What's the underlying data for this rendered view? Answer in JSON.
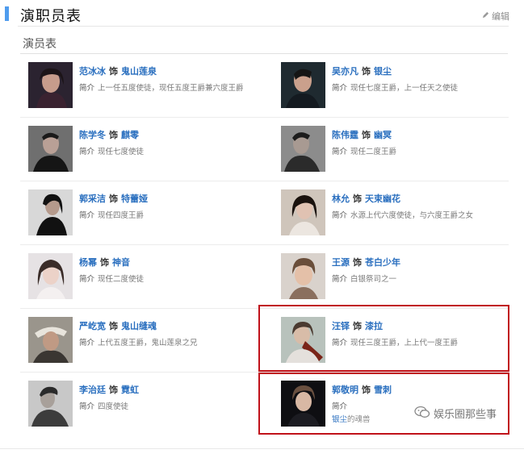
{
  "header": {
    "title": "演职员表",
    "edit_label": "编辑"
  },
  "section": {
    "title": "演员表"
  },
  "cast": [
    {
      "actor": "范冰冰",
      "plays": "饰",
      "role": "鬼山莲泉",
      "bio_label": "简介",
      "bio": "上一任五度使徒，现任五度王爵兼六度王爵"
    },
    {
      "actor": "吴亦凡",
      "plays": "饰",
      "role": "银尘",
      "bio_label": "简介",
      "bio": "现任七度王爵，上一任天之使徒"
    },
    {
      "actor": "陈学冬",
      "plays": "饰",
      "role": "麒零",
      "bio_label": "简介",
      "bio": "现任七度使徒"
    },
    {
      "actor": "陈伟霆",
      "plays": "饰",
      "role": "幽冥",
      "bio_label": "简介",
      "bio": "现任二度王爵"
    },
    {
      "actor": "郭采洁",
      "plays": "饰",
      "role": "特蕾娅",
      "bio_label": "简介",
      "bio": "现任四度王爵"
    },
    {
      "actor": "林允",
      "plays": "饰",
      "role": "天束幽花",
      "bio_label": "简介",
      "bio": "水源上代六度使徒，与六度王爵之女"
    },
    {
      "actor": "杨幂",
      "plays": "饰",
      "role": "神音",
      "bio_label": "简介",
      "bio": "现任二度使徒"
    },
    {
      "actor": "王源",
      "plays": "饰",
      "role": "苍白少年",
      "bio_label": "简介",
      "bio": "白银祭司之一"
    },
    {
      "actor": "严屹宽",
      "plays": "饰",
      "role": "鬼山缝魂",
      "bio_label": "简介",
      "bio": "上代五度王爵，鬼山莲泉之兄"
    },
    {
      "actor": "汪铎",
      "plays": "饰",
      "role": "漆拉",
      "bio_label": "简介",
      "bio": "现任三度王爵，上上代一度王爵"
    },
    {
      "actor": "李治廷",
      "plays": "饰",
      "role": "霓虹",
      "bio_label": "简介",
      "bio": "四度使徒"
    },
    {
      "actor": "郭敬明",
      "plays": "饰",
      "role": "雪刺",
      "bio_label": "简介",
      "bio": "",
      "extra_link": "银尘",
      "extra_text": "的魂兽"
    }
  ],
  "watermark": {
    "text": "娱乐圈那些事"
  },
  "colors": {
    "accent": "#4f9cee",
    "link": "#2a6fbf",
    "highlight_box": "#c0121a"
  }
}
